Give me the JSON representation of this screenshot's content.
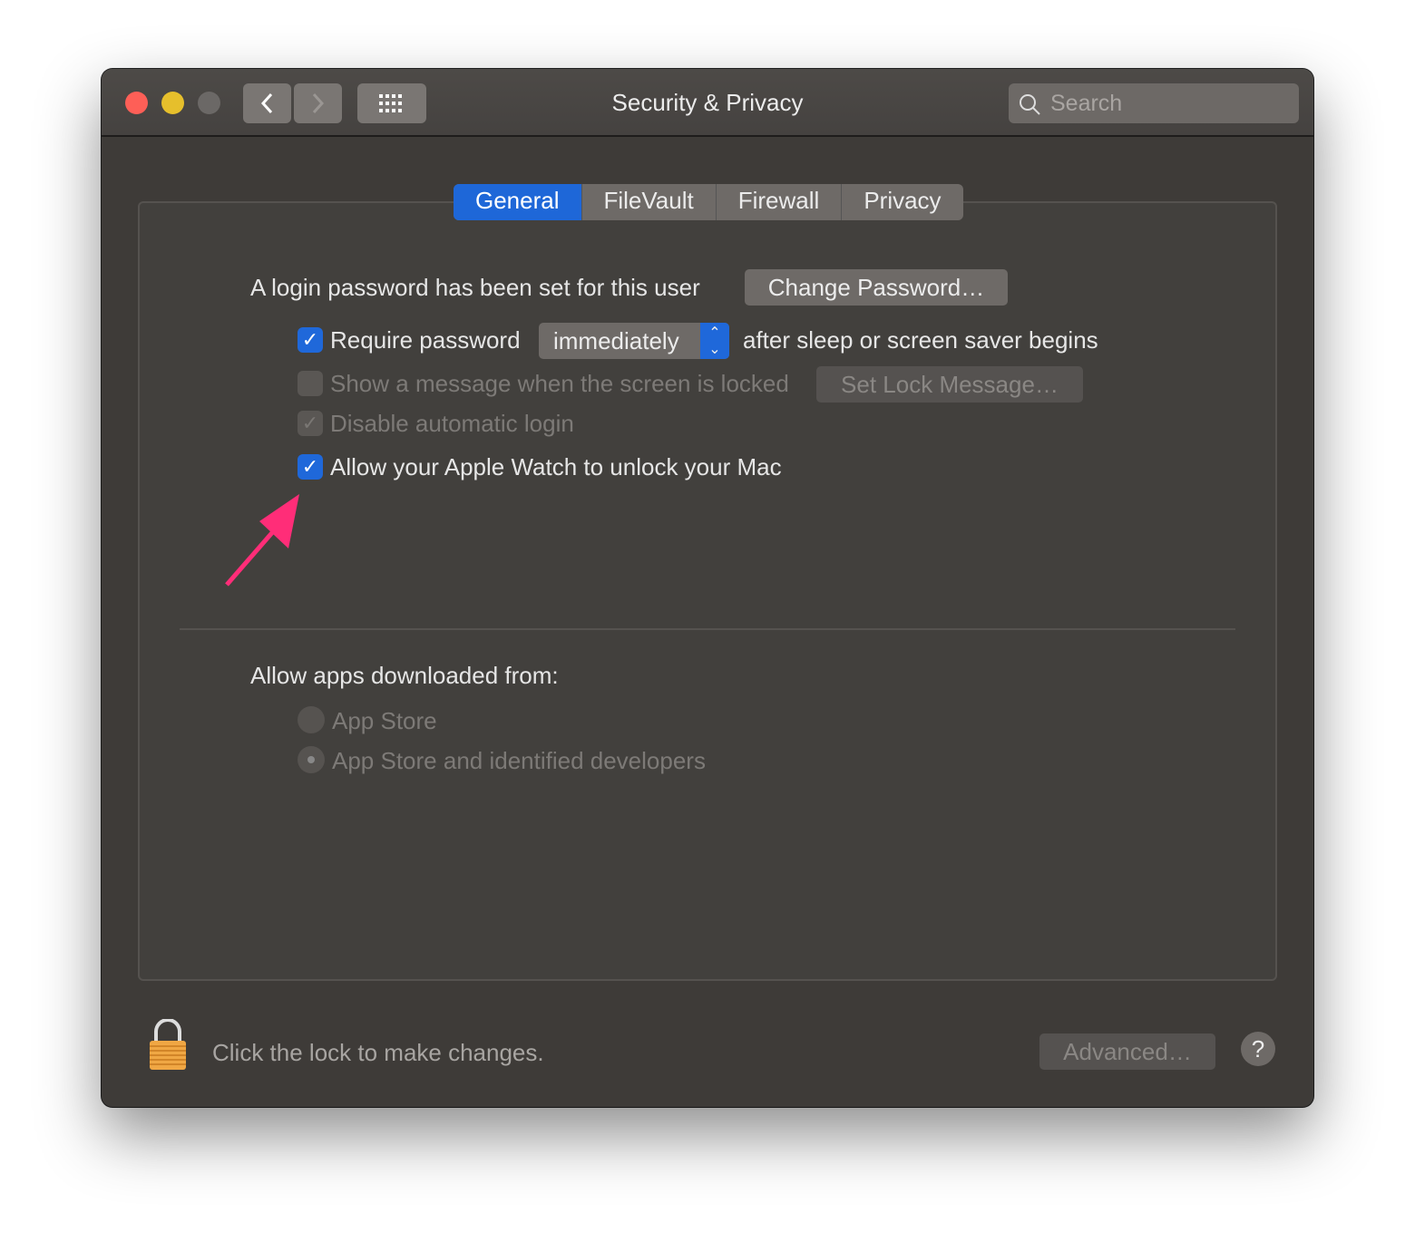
{
  "window": {
    "title": "Security & Privacy",
    "search_placeholder": "Search"
  },
  "tabs": [
    {
      "label": "General",
      "selected": true
    },
    {
      "label": "FileVault"
    },
    {
      "label": "Firewall"
    },
    {
      "label": "Privacy"
    }
  ],
  "general": {
    "login_text": "A login password has been set for this user",
    "change_password": "Change Password…",
    "require_password": {
      "label": "Require password",
      "checked": true,
      "value": "immediately",
      "suffix": "after sleep or screen saver begins"
    },
    "show_message": {
      "label": "Show a message when the screen is locked",
      "checked": false,
      "button": "Set Lock Message…"
    },
    "disable_login": {
      "label": "Disable automatic login",
      "checked": true
    },
    "apple_watch": {
      "label": "Allow your Apple Watch to unlock your Mac",
      "checked": true
    },
    "allow_apps_label": "Allow apps downloaded from:",
    "radio_options": [
      {
        "label": "App Store",
        "selected": false
      },
      {
        "label": "App Store and identified developers",
        "selected": true
      }
    ]
  },
  "footer": {
    "lock_text": "Click the lock to make changes.",
    "advanced": "Advanced…",
    "help": "?"
  },
  "colors": {
    "accent": "#1e67d8",
    "arrow": "#ff2d78"
  }
}
